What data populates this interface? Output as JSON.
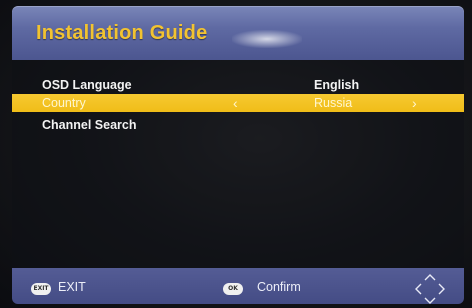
{
  "header": {
    "title": "Installation Guide"
  },
  "menu": {
    "rows": [
      {
        "label": "OSD Language",
        "value": "English"
      },
      {
        "label": "Country",
        "value": "Russia",
        "selected": true
      },
      {
        "label": "Channel Search",
        "value": ""
      }
    ],
    "arrow_left": "‹",
    "arrow_right": "›"
  },
  "footer": {
    "exit_key": "EXIT",
    "exit_label": "EXIT",
    "ok_key": "OK",
    "confirm_label": "Confirm",
    "nav_icon": "dpad-arrows-icon"
  },
  "colors": {
    "title": "#f2c331",
    "highlight": "#f2c228",
    "header_bar": "#5f6aa3",
    "footer_bar": "#4c5490"
  }
}
